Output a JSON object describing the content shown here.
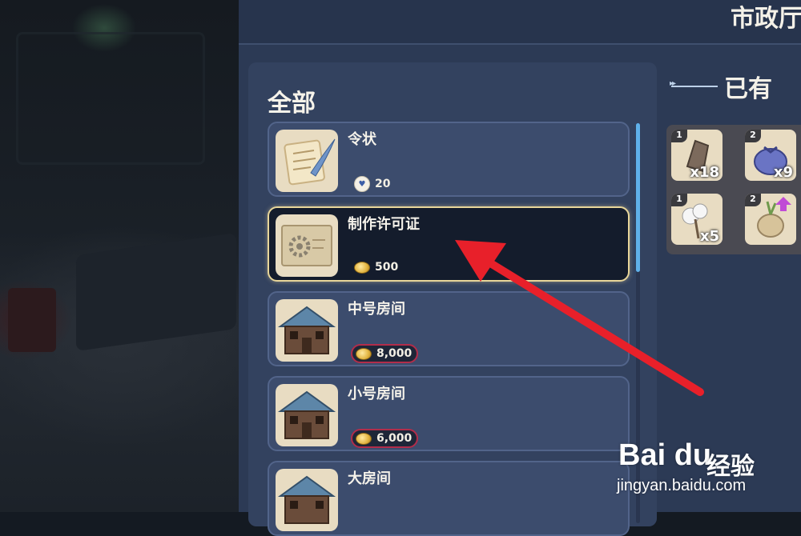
{
  "header": {
    "title": "市政厅"
  },
  "list": {
    "section_title": "全部",
    "items": [
      {
        "name": "令状",
        "price": "20",
        "currency_icon": "token-icon",
        "short": false,
        "selected": false,
        "thumb": "scroll-quill-icon"
      },
      {
        "name": "制作许可证",
        "price": "500",
        "currency_icon": "coin-icon",
        "short": false,
        "selected": true,
        "thumb": "license-gear-icon"
      },
      {
        "name": "中号房间",
        "price": "8,000",
        "currency_icon": "coin-icon",
        "short": true,
        "selected": false,
        "thumb": "house-icon"
      },
      {
        "name": "小号房间",
        "price": "6,000",
        "currency_icon": "coin-icon",
        "short": true,
        "selected": false,
        "thumb": "house-icon"
      },
      {
        "name": "大房间",
        "price": "",
        "currency_icon": "coin-icon",
        "short": false,
        "selected": false,
        "thumb": "house-icon"
      }
    ]
  },
  "owned": {
    "title": "已有",
    "slots": [
      {
        "level": "1",
        "qty": "x18",
        "icon": "stone-icon"
      },
      {
        "level": "2",
        "qty": "x9",
        "icon": "sack-icon"
      },
      {
        "level": "1",
        "qty": "x5",
        "icon": "cotton-icon"
      },
      {
        "level": "2",
        "qty": "",
        "icon": "onion-icon",
        "upgrade": true
      }
    ]
  },
  "watermark": {
    "logo": "Bai du",
    "cn": "经验",
    "url": "jingyan.baidu.com"
  },
  "colors": {
    "accent_selected": "#e8d69a",
    "shortage_border": "#b22d4a",
    "scroll_thumb": "#5fb1ea",
    "arrow": "#e8202a"
  }
}
